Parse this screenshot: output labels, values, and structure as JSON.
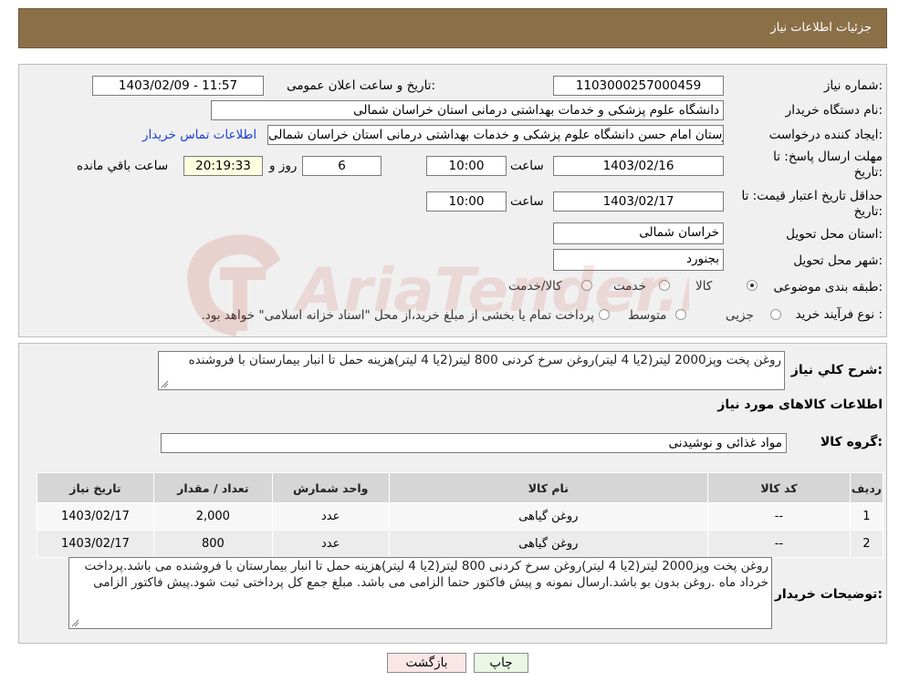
{
  "header": {
    "title": "جزئیات اطلاعات نیاز"
  },
  "form": {
    "need_number_label": "شماره نیاز:",
    "need_number": "1103000257000459",
    "announce_label": "تاریخ و ساعت اعلان عمومی:",
    "announce_value": "1403/02/09 - 11:57",
    "buyer_org_label": "نام دستگاه خریدار:",
    "buyer_org": "دانشگاه علوم پزشکی و خدمات بهداشتی درمانی استان خراسان شمالی",
    "requester_label": "ایجاد کننده درخواست:",
    "requester": "کوروش نیکوسرشت کارپرداز بیمارستان امام حسن دانشگاه علوم پزشکی و خدمات بهداشتی درمانی استان خراسان شمالی",
    "contact_link": "اطلاعات تماس خریدار",
    "deadline_label_1": "مهلت ارسال پاسخ: تا",
    "deadline_label_2": "تاریخ:",
    "deadline_date": "1403/02/16",
    "time_label": "ساعت",
    "deadline_time": "10:00",
    "days_value": "6",
    "days_label": "روز و",
    "remaining_time": "20:19:33",
    "remaining_label": "ساعت باقي مانده",
    "validity_label_1": "حداقل تاریخ اعتبار قیمت: تا",
    "validity_label_2": "تاریخ:",
    "validity_date": "1403/02/17",
    "validity_time": "10:00",
    "province_label": "استان محل تحویل:",
    "province": "خراسان شمالی",
    "city_label": "شهر محل تحویل:",
    "city": "بجنورد",
    "category_label": "طبقه بندی موضوعی:",
    "category_options": [
      "کالا",
      "خدمت",
      "کالا/خدمت"
    ],
    "category_selected": "کالا",
    "process_label": "نوع فرآیند خرید :",
    "process_options": [
      "جزیی",
      "متوسط"
    ],
    "process_note": "پرداخت تمام یا بخشی از مبلغ خرید،از محل \"اسناد خزانه اسلامی\" خواهد بود."
  },
  "summary": {
    "label": "شرح کلي نیاز:",
    "text": "روغن پخت وپز2000 لیتر(2یا 4 لیتر)روغن سرخ کردنی 800 لیتر(2یا 4 لیتر)هزینه حمل تا انبار بیمارستان با فروشنده"
  },
  "goods": {
    "section_title": "اطلاعات کالاهای مورد نیاز",
    "group_label": "گروه کالا:",
    "group_value": "مواد غذائی و نوشیدنی",
    "columns": [
      "ردیف",
      "کد کالا",
      "نام کالا",
      "واحد شمارش",
      "تعداد / مقدار",
      "تاریخ نیاز"
    ],
    "rows": [
      [
        "1",
        "--",
        "روغن گیاهی",
        "عدد",
        "2,000",
        "1403/02/17"
      ],
      [
        "2",
        "--",
        "روغن گیاهی",
        "عدد",
        "800",
        "1403/02/17"
      ]
    ]
  },
  "notes": {
    "label": "توضیحات خریدار:",
    "text": "روغن پخت وپز2000 لیتر(2یا 4 لیتر)روغن سرخ کردنی 800 لیتر(2یا 4 لیتر)هزینه حمل تا انبار بیمارستان با فروشنده می باشد.پرداخت خرداد ماه .روغن بدون بو باشد.ارسال نمونه و پیش فاکتور حتما الزامی می باشد. مبلغ جمع کل پرداختی ثبت شود.پیش فاکتور الزامی"
  },
  "buttons": {
    "print": "چاپ",
    "back": "بازگشت"
  },
  "watermark": {
    "text": "AriaTender.neT"
  }
}
